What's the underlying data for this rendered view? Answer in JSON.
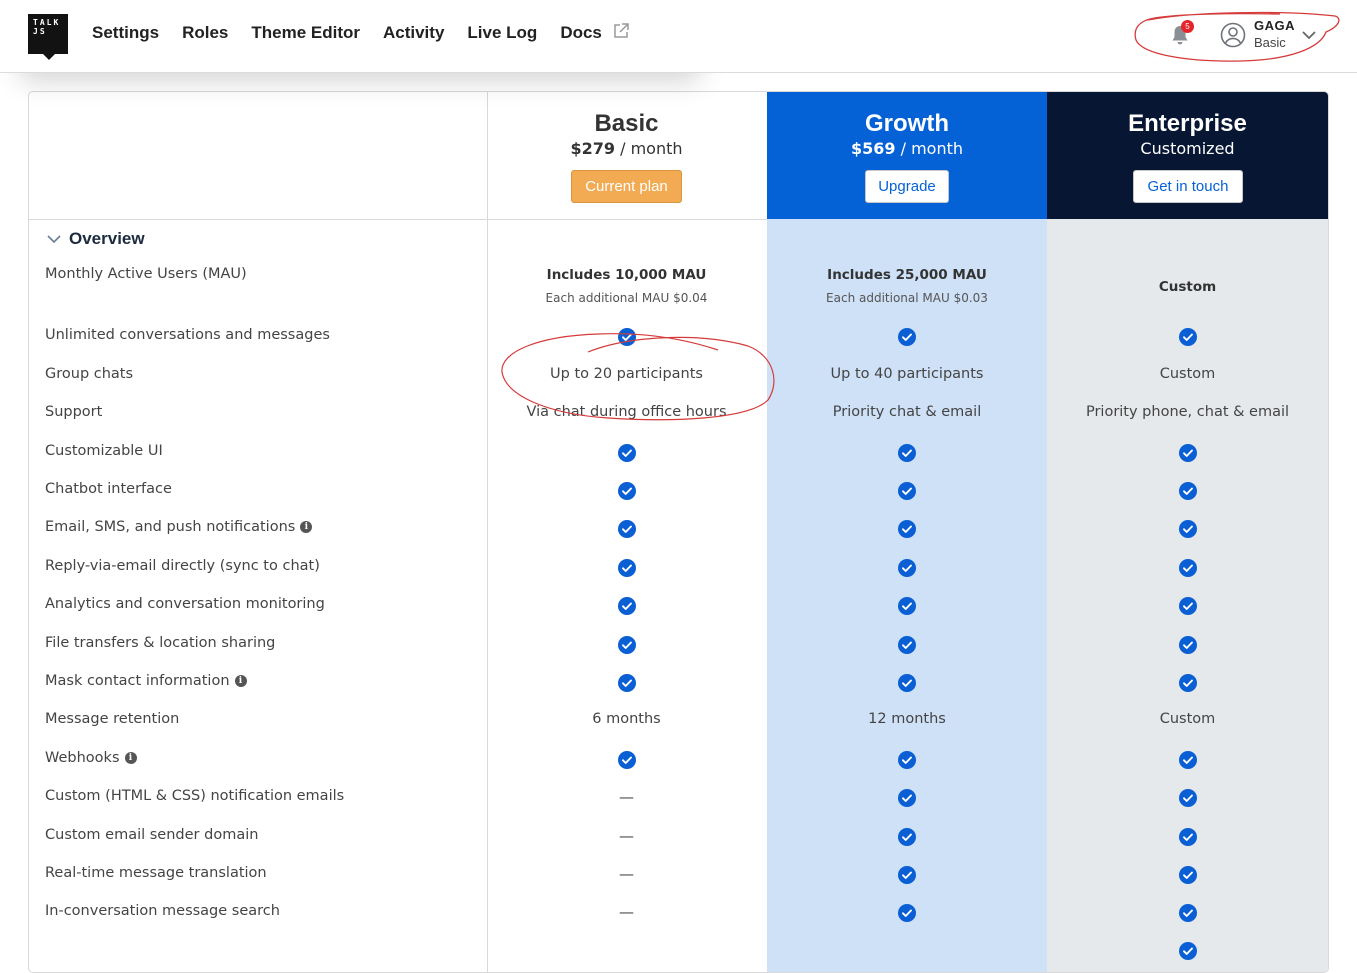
{
  "nav": {
    "logo_lines": [
      "TALK",
      "JS"
    ],
    "items": [
      "Settings",
      "Roles",
      "Theme Editor",
      "Activity",
      "Live Log",
      "Docs"
    ],
    "notification_count": "5",
    "user_name": "GAGA",
    "user_plan": "Basic"
  },
  "plans": {
    "basic": {
      "name": "Basic",
      "price": "$279",
      "period": "/ month",
      "button": "Current plan"
    },
    "growth": {
      "name": "Growth",
      "price": "$569",
      "period": "/ month",
      "button": "Upgrade"
    },
    "enterprise": {
      "name": "Enterprise",
      "subtitle": "Customized",
      "button": "Get in touch"
    }
  },
  "section": {
    "title": "Overview"
  },
  "mau": {
    "label": "Monthly Active Users (MAU)",
    "basic": "Includes 10,000 MAU",
    "basic_sub": "Each additional MAU $0.04",
    "growth": "Includes 25,000 MAU",
    "growth_sub": "Each additional MAU $0.03",
    "enterprise": "Custom"
  },
  "rows": [
    {
      "label": "Unlimited conversations and messages",
      "info": false,
      "basic": "check",
      "growth": "check",
      "enterprise": "check"
    },
    {
      "label": "Group chats",
      "info": false,
      "basic": "Up to 20 participants",
      "growth": "Up to 40 participants",
      "enterprise": "Custom"
    },
    {
      "label": "Support",
      "info": false,
      "basic": "Via chat during office hours",
      "growth": "Priority chat & email",
      "enterprise": "Priority phone, chat & email"
    },
    {
      "label": "Customizable UI",
      "info": false,
      "basic": "check",
      "growth": "check",
      "enterprise": "check"
    },
    {
      "label": "Chatbot interface",
      "info": false,
      "basic": "check",
      "growth": "check",
      "enterprise": "check"
    },
    {
      "label": "Email, SMS, and push notifications",
      "info": true,
      "basic": "check",
      "growth": "check",
      "enterprise": "check"
    },
    {
      "label": "Reply-via-email directly (sync to chat)",
      "info": false,
      "basic": "check",
      "growth": "check",
      "enterprise": "check"
    },
    {
      "label": "Analytics and conversation monitoring",
      "info": false,
      "basic": "check",
      "growth": "check",
      "enterprise": "check"
    },
    {
      "label": "File transfers & location sharing",
      "info": false,
      "basic": "check",
      "growth": "check",
      "enterprise": "check"
    },
    {
      "label": "Mask contact information",
      "info": true,
      "basic": "check",
      "growth": "check",
      "enterprise": "check"
    },
    {
      "label": "Message retention",
      "info": false,
      "basic": "6 months",
      "growth": "12 months",
      "enterprise": "Custom"
    },
    {
      "label": "Webhooks",
      "info": true,
      "basic": "check",
      "growth": "check",
      "enterprise": "check"
    },
    {
      "label": "Custom (HTML & CSS) notification emails",
      "info": false,
      "basic": "—",
      "growth": "check",
      "enterprise": "check"
    },
    {
      "label": "Custom email sender domain",
      "info": false,
      "basic": "—",
      "growth": "check",
      "enterprise": "check"
    },
    {
      "label": "Real-time message translation",
      "info": false,
      "basic": "—",
      "growth": "check",
      "enterprise": "check"
    },
    {
      "label": "In-conversation message search",
      "info": false,
      "basic": "—",
      "growth": "check",
      "enterprise": "check"
    },
    {
      "label": "",
      "info": false,
      "basic": "",
      "growth": "",
      "enterprise": "check"
    }
  ],
  "colors": {
    "check_blue": "#0a5fd4",
    "growth_header": "#0561d6",
    "growth_body": "#cfe1f7",
    "enterprise_header": "#071733",
    "enterprise_body": "#e6e9ec",
    "current_plan_button": "#f2ab52",
    "annotation_red": "#d63a3a"
  }
}
